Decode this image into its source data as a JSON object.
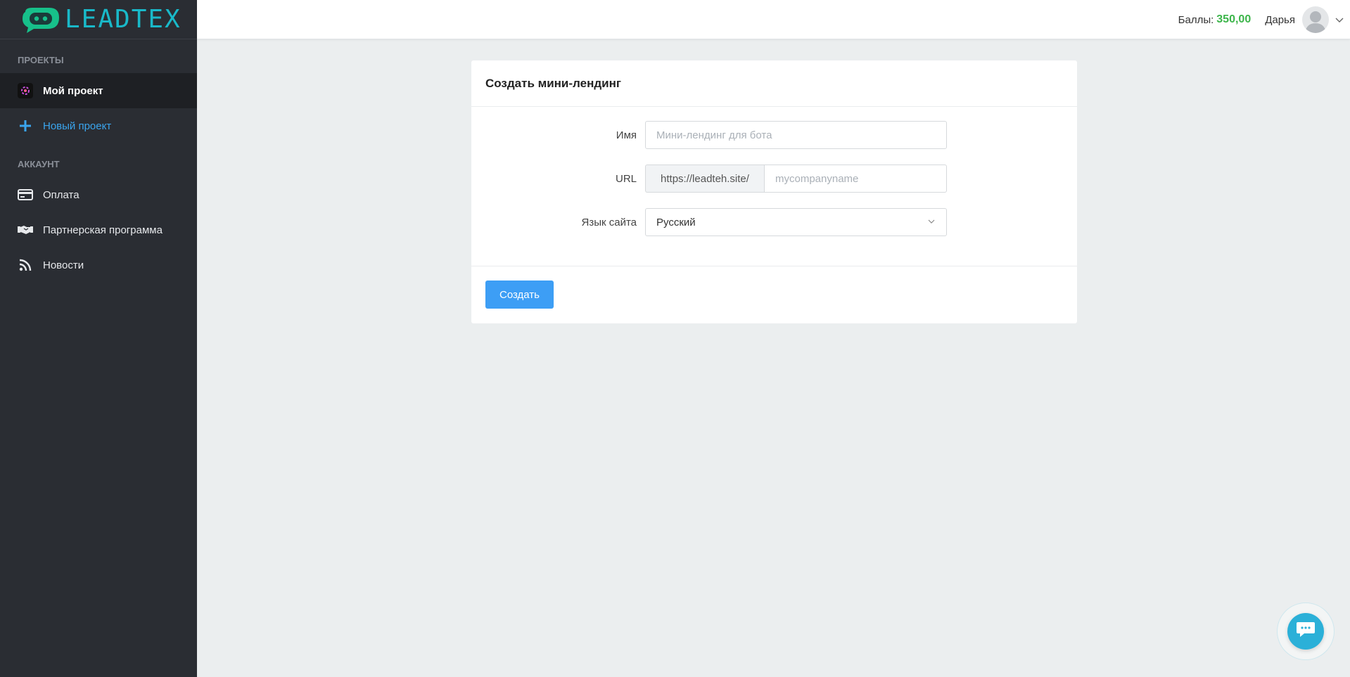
{
  "brand": {
    "logo_text": "LEADTEX"
  },
  "sidebar": {
    "projects_title": "ПРОЕКТЫ",
    "projects": [
      {
        "label": "Мой проект",
        "icon": "project-icon",
        "active": true
      },
      {
        "label": "Новый проект",
        "icon": "plus-icon"
      }
    ],
    "account_title": "АККАУНТ",
    "account_items": [
      {
        "label": "Оплата",
        "icon": "credit-card-icon"
      },
      {
        "label": "Партнерская программа",
        "icon": "handshake-icon"
      },
      {
        "label": "Новости",
        "icon": "rss-icon"
      }
    ]
  },
  "topbar": {
    "points_label": "Баллы:",
    "points_value": "350,00",
    "user_name": "Дарья"
  },
  "form": {
    "title": "Создать мини-лендинг",
    "name_label": "Имя",
    "name_placeholder": "Мини-лендинг для бота",
    "url_label": "URL",
    "url_prefix": "https://leadteh.site/",
    "url_placeholder": "mycompanyname",
    "lang_label": "Язык сайта",
    "lang_value": "Русский",
    "submit_label": "Создать"
  },
  "colors": {
    "sidebar_bg": "#2a2d33",
    "accent_blue": "#3d9ef5",
    "points_green": "#3cb54a",
    "logo_teal": "#19b9c9",
    "chat_teal": "#2bb0d8"
  }
}
